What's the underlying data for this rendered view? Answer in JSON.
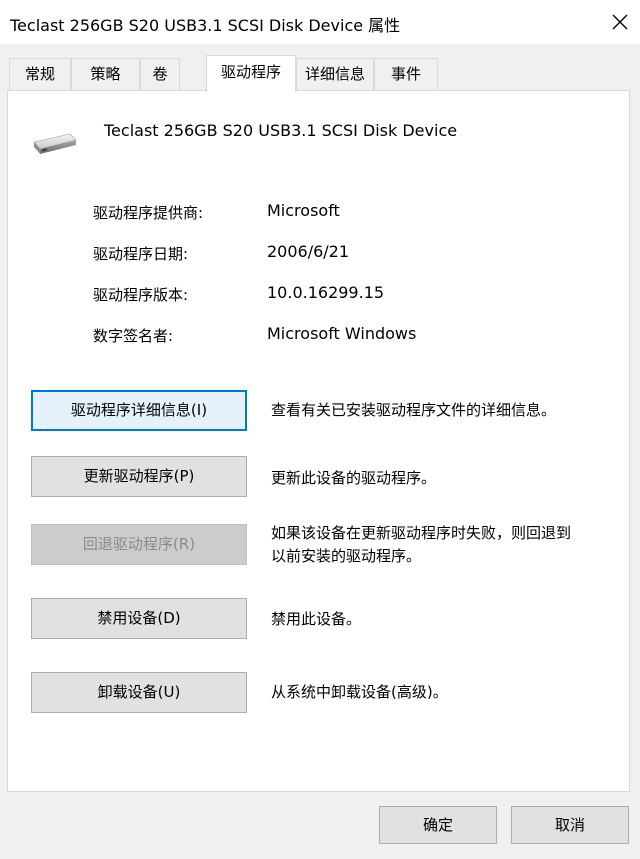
{
  "window": {
    "title": "Teclast 256GB S20 USB3.1 SCSI Disk Device 属性",
    "close_icon": "close-icon"
  },
  "tabs": [
    {
      "label": "常规",
      "active": false
    },
    {
      "label": "策略",
      "active": false
    },
    {
      "label": "卷",
      "active": false
    },
    {
      "label": "驱动程序",
      "active": true
    },
    {
      "label": "详细信息",
      "active": false
    },
    {
      "label": "事件",
      "active": false
    }
  ],
  "device": {
    "icon": "disk-drive-icon",
    "name": "Teclast 256GB S20 USB3.1 SCSI Disk Device"
  },
  "properties": [
    {
      "label": "驱动程序提供商:",
      "value": "Microsoft"
    },
    {
      "label": "驱动程序日期:",
      "value": "2006/6/21"
    },
    {
      "label": "驱动程序版本:",
      "value": "10.0.16299.15"
    },
    {
      "label": "数字签名者:",
      "value": "Microsoft Windows"
    }
  ],
  "actions": [
    {
      "label": "驱动程序详细信息(I)",
      "description": [
        "查看有关已安装驱动程序文件的详细信息。"
      ],
      "enabled": true,
      "focused": true
    },
    {
      "label": "更新驱动程序(P)",
      "description": [
        "更新此设备的驱动程序。"
      ],
      "enabled": true,
      "focused": false
    },
    {
      "label": "回退驱动程序(R)",
      "description": [
        "如果该设备在更新驱动程序时失败，则回退到",
        "以前安装的驱动程序。"
      ],
      "enabled": false,
      "focused": false
    },
    {
      "label": "禁用设备(D)",
      "description": [
        "禁用此设备。"
      ],
      "enabled": true,
      "focused": false
    },
    {
      "label": "卸载设备(U)",
      "description": [
        "从系统中卸载设备(高级)。"
      ],
      "enabled": true,
      "focused": false
    }
  ],
  "footer": {
    "ok_label": "确定",
    "cancel_label": "取消"
  },
  "colors": {
    "focus_border": "#0078d7",
    "disabled_text": "#8a8a8a"
  }
}
